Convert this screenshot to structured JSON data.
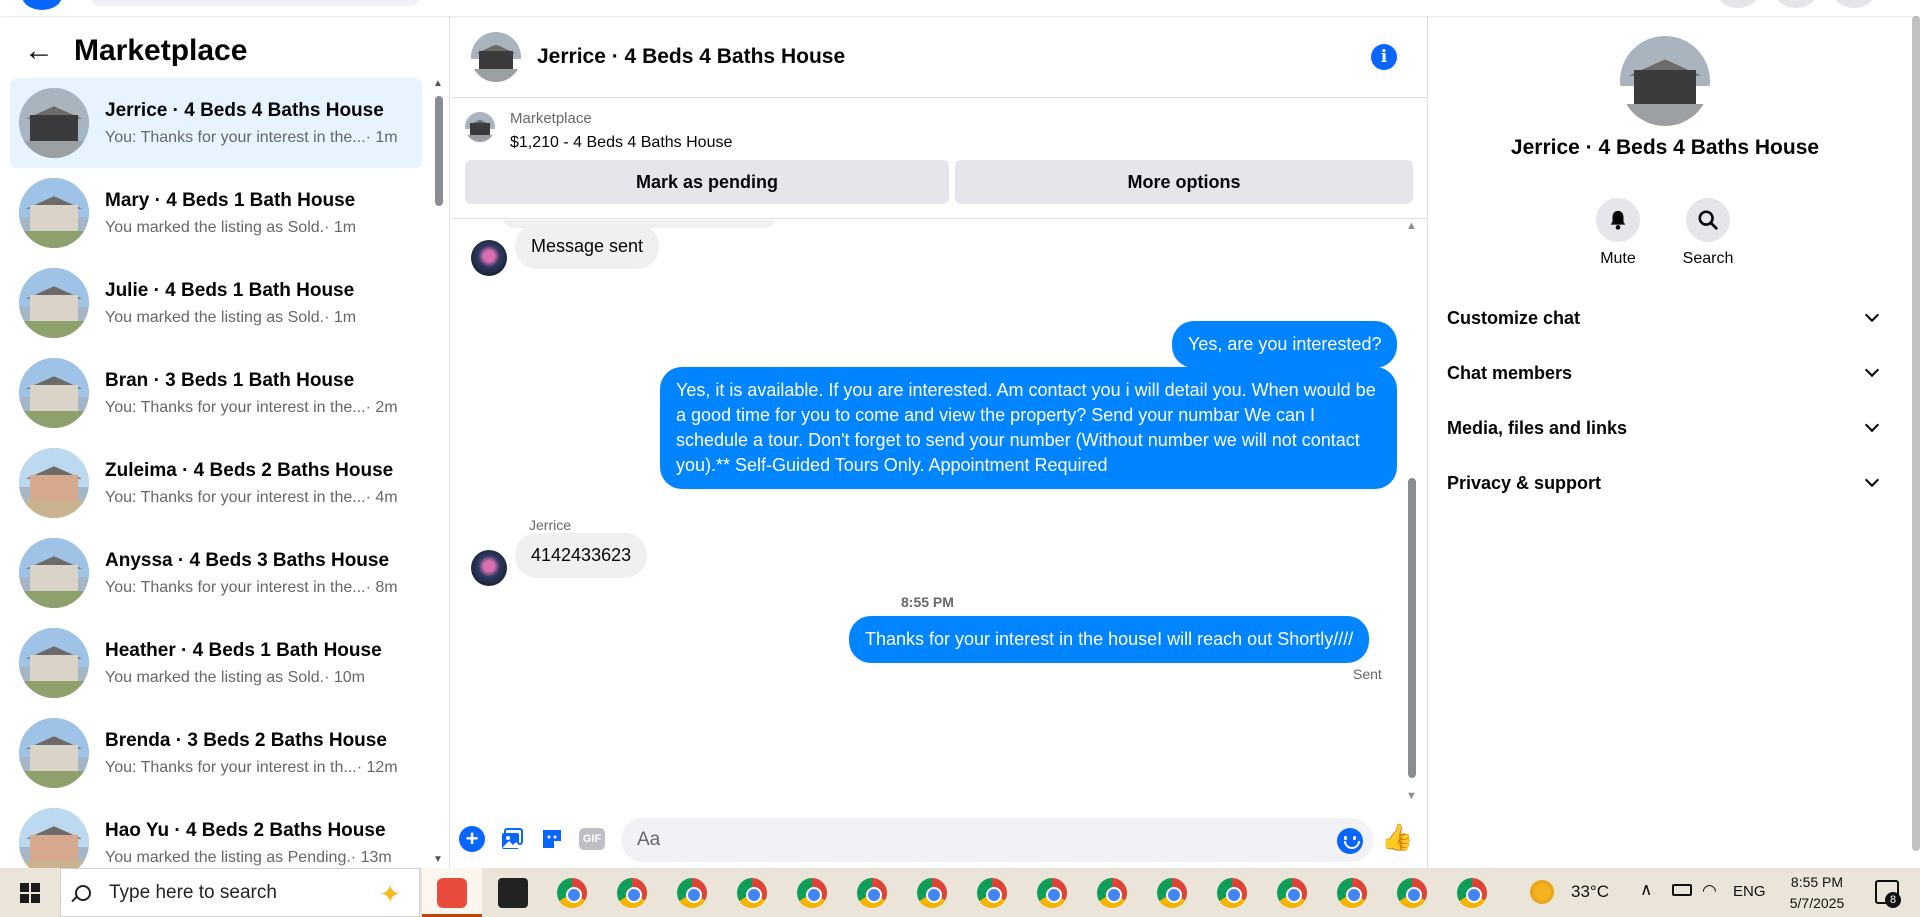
{
  "sidebar": {
    "title": "Marketplace",
    "back_icon": "←",
    "conversations": [
      {
        "name": "Jerrice · 4 Beds 4 Baths House",
        "preview": "You: Thanks for your interest in the...",
        "time": "· 1m",
        "active": true
      },
      {
        "name": "Mary · 4 Beds 1 Bath House",
        "preview": "You marked the listing as Sold.",
        "time": "· 1m"
      },
      {
        "name": "Julie · 4 Beds 1 Bath House",
        "preview": "You marked the listing as Sold.",
        "time": "· 1m"
      },
      {
        "name": "Bran · 3 Beds 1 Bath House",
        "preview": "You: Thanks for your interest in the...",
        "time": "· 2m"
      },
      {
        "name": "Zuleima · 4 Beds 2 Baths House",
        "preview": "You: Thanks for your interest in the...",
        "time": "· 4m"
      },
      {
        "name": "Anyssa · 4 Beds 3 Baths House",
        "preview": "You: Thanks for your interest in the...",
        "time": "· 8m"
      },
      {
        "name": "Heather · 4 Beds 1 Bath House",
        "preview": "You marked the listing as Sold.",
        "time": "· 10m"
      },
      {
        "name": "Brenda · 3 Beds 2 Baths House",
        "preview": "You: Thanks for your interest in th...",
        "time": "· 12m"
      },
      {
        "name": "Hao Yu · 4 Beds 2 Baths House",
        "preview": "You marked the listing as Pending.",
        "time": "· 13m"
      }
    ]
  },
  "chat": {
    "header_title": "Jerrice · 4 Beds 4 Baths House",
    "info_icon": "i",
    "listing_source": "Marketplace",
    "listing_name": "$1,210 - 4 Beds 4 Baths House",
    "mark_pending_label": "Mark as pending",
    "more_options_label": "More options",
    "messages": {
      "m1": "Message sent",
      "m2": "Yes, are you interested?",
      "m3": "Yes, it is available. If you are interested.  Am contact you i will detail you.  When would be a good time for you to come and view the property? Send your numbar We can I schedule a tour.  Don't forget to send your number (Without number we will not contact you).** Self-Guided Tours Only. Appointment Required",
      "sender": "Jerrice",
      "m4": "4142433623",
      "time": "8:55 PM",
      "m5": "Thanks for your interest in the houseI will reach out Shortly////",
      "status": "Sent"
    },
    "composer_placeholder": "Aa",
    "gif_label": "GIF",
    "plus_icon": "+",
    "like_icon": "👍"
  },
  "info_panel": {
    "title": "Jerrice · 4 Beds 4 Baths House",
    "mute_label": "Mute",
    "search_label": "Search",
    "bell_icon": "🔔",
    "search_icon": "🔍",
    "sections": [
      "Customize chat",
      "Chat members",
      "Media, files and links",
      "Privacy & support"
    ]
  },
  "taskbar": {
    "search_placeholder": "Type here to search",
    "temperature": "33°C",
    "language": "ENG",
    "time": "8:55 PM",
    "date": "5/7/2025",
    "notifications": "8",
    "spark_icon": "✦",
    "chevron_icon": "∧"
  },
  "colors": {
    "accent": "#0084ff",
    "brand": "#0866ff",
    "active_row": "#e7f3ff"
  }
}
